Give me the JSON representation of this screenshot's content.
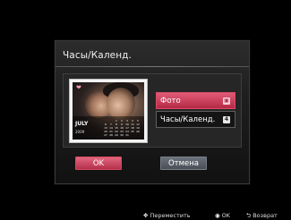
{
  "dialog": {
    "title": "Часы/Календ.",
    "preview": {
      "calendar_month": "JULY",
      "calendar_year": "2009",
      "calendar_days": [
        "",
        "",
        "1",
        "2",
        "3",
        "4",
        "5",
        "6",
        "7",
        "8",
        "9",
        "10",
        "11",
        "12",
        "13",
        "14",
        "15",
        "16",
        "17",
        "18",
        "19",
        "20",
        "21",
        "22",
        "23",
        "24",
        "25",
        "26",
        "27",
        "28",
        "29",
        "30",
        "31",
        "",
        ""
      ]
    },
    "options": [
      {
        "label": "Фото",
        "key": "a",
        "selected": true
      },
      {
        "label": "Часы/Календ.",
        "key": "4",
        "selected": false
      }
    ],
    "ok_label": "OK",
    "cancel_label": "Отмена"
  },
  "hints": {
    "move": "Переместить",
    "ok": "OK",
    "back": "Возврат"
  },
  "colors": {
    "accent": "#c43a55",
    "cancel": "#59606a",
    "background": "#000000"
  }
}
